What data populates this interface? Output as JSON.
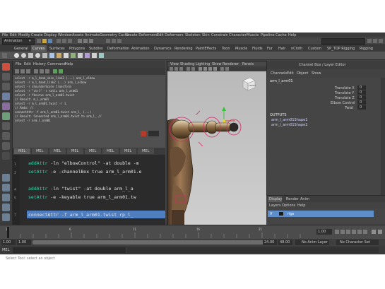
{
  "app": {
    "menu_items": [
      "File",
      "Edit",
      "Modify",
      "Create",
      "Display",
      "Window",
      "Assets",
      "Animate",
      "Geometry Cache",
      "Create Deformers",
      "Edit Deformers",
      "Skeleton",
      "Skin",
      "Constrain",
      "Character",
      "Muscle",
      "Pipeline Cache",
      "Help"
    ],
    "mode_selector": "Animation"
  },
  "shelf_tabs": [
    "General",
    "Curves",
    "Surfaces",
    "Polygons",
    "Subdivs",
    "Deformation",
    "Animation",
    "Dynamics",
    "Rendering",
    "PaintEffects",
    "Toon",
    "Muscle",
    "Fluids",
    "Fur",
    "Hair",
    "nCloth",
    "Custom",
    "SP_TOP Rigging",
    "Rigging"
  ],
  "script_editor": {
    "menu": [
      "File",
      "Edit",
      "History",
      "Command",
      "Help"
    ],
    "history_lines": [
      "select -r m_l_hand_skin_link2 (...) arm_l_elbow",
      "select -r m_l_hand_link2 (...) arm_l_elbow",
      "select -r shoulderScale transform",
      "select -r \"ctrl\" -r notic arm_l_arm01",
      "select -r fkcurve arm_l_arm01.twist",
      "// Result: m_l_arm01",
      "select -r m_l_arm01.twist -r 1.",
      "// Redo: //",
      "connectAttr -f arm_l_arm01.twist arm_l_ (...)",
      "// Result: Connected arm_l_arm01.twist to arm_l_ //",
      "select -r arm_l_arm01"
    ],
    "tabs": [
      "MEL",
      "MEL",
      "MEL",
      "MEL",
      "MEL",
      "MEL",
      "MEL",
      "MEL"
    ],
    "code_lines": [
      {
        "num": "1",
        "kw": "addAttr",
        "rest": " -ln \"elbowControl\" -at double -m"
      },
      {
        "num": "2",
        "kw": "setAttr",
        "rest": " -e -channelBox true arm_l_arm01.e"
      },
      {
        "num": "3",
        "kw": "",
        "rest": ""
      },
      {
        "num": "4",
        "kw": "addAttr",
        "rest": " -ln \"twist\" -at double arm_l_a"
      },
      {
        "num": "5",
        "kw": "setAttr",
        "rest": " -e -keyable true arm_l_arm01.tw"
      },
      {
        "num": "6",
        "kw": "",
        "rest": ""
      },
      {
        "num": "7",
        "kw": "connectAttr",
        "rest": " -f arm_l_arm01.twist rp_l_"
      }
    ]
  },
  "viewport": {
    "menu": [
      "View",
      "Shading",
      "Lighting",
      "Show",
      "Renderer",
      "Panels"
    ],
    "camera_label": "persp",
    "viewcube_label": "FRONT"
  },
  "channel_box": {
    "title": "Channel Box / Layer Editor",
    "menu": [
      "Channels",
      "Edit",
      "Object",
      "Show"
    ],
    "object_name": "arm_l_arm01",
    "attributes": [
      {
        "name": "Translate X",
        "value": "0"
      },
      {
        "name": "Translate Y",
        "value": "0"
      },
      {
        "name": "Translate Z",
        "value": "0"
      },
      {
        "name": "Elbow Control",
        "value": "0"
      },
      {
        "name": "Twist",
        "value": "0"
      }
    ],
    "section_label": "OUTPUTS",
    "outputs": [
      "arm_l_arm01Shape1",
      "arm_l_arm01Shape2"
    ]
  },
  "layer_editor": {
    "tabs": [
      "Display",
      "Render",
      "Anim"
    ],
    "menu": [
      "Layers",
      "Options",
      "Help"
    ],
    "layers": [
      {
        "visible": "V",
        "name": "rigs"
      }
    ]
  },
  "timeline": {
    "ticks": [
      "1",
      "2",
      "3",
      "4",
      "5",
      "6",
      "7",
      "8",
      "9",
      "10",
      "11",
      "12",
      "13",
      "14",
      "15",
      "16",
      "17",
      "18",
      "19",
      "20",
      "21",
      "22",
      "23",
      "24"
    ],
    "current_frame": "1.00"
  },
  "range_slider": {
    "start": "1.00",
    "inner_start": "1.00",
    "end": "24.00",
    "inner_end": "48.00",
    "anim_layer": "No Anim Layer",
    "char_set": "No Character Set"
  },
  "command_line": {
    "label": "MEL",
    "help_line": "Select Tool: select an object"
  },
  "colors": {
    "ui_bg": "#444444",
    "script_bg": "#2b2b2b",
    "keyword": "#35d6a8",
    "highlight": "#4f7ec0",
    "selected_layer": "#5e8ec9",
    "viewport_bg": "#c9c9c9",
    "outputs_text": "#d0d0ff"
  }
}
